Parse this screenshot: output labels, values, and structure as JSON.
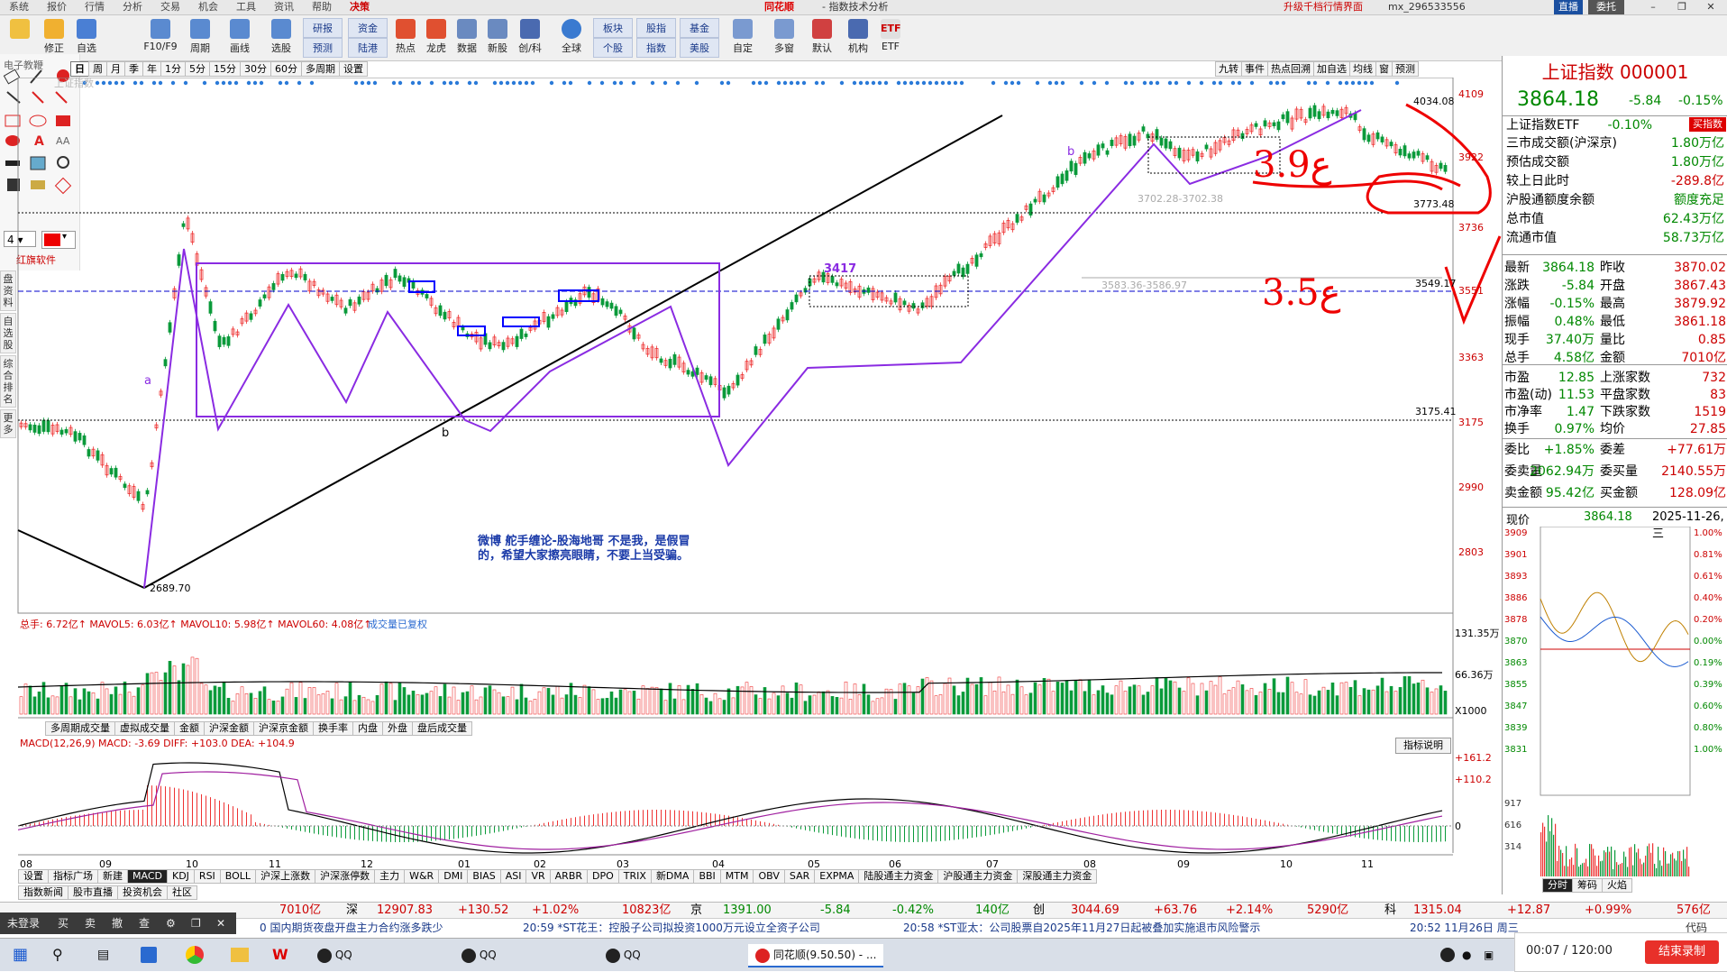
{
  "menu": {
    "items": [
      "系统",
      "报价",
      "行情",
      "分析",
      "交易",
      "机会",
      "工具",
      "资讯",
      "帮助",
      "决策"
    ],
    "logo": "同花顺",
    "window_title": "- 指数技术分析",
    "upgrade": "升级千档行情界面",
    "account": "mx_296533556",
    "direct": "直播",
    "invest": "委托"
  },
  "toolbar": {
    "buttons": [
      "修正",
      "自选",
      "F10/F9",
      "周期",
      "画线",
      "选股",
      "热点",
      "龙虎",
      "数据",
      "新股",
      "创/科",
      "全球",
      "自定",
      "多窗",
      "默认",
      "机构",
      "ETF"
    ],
    "pairs": [
      [
        "研报",
        "预测"
      ],
      [
        "资金",
        "陆港"
      ],
      [
        "板块",
        "个股"
      ],
      [
        "股指",
        "指数"
      ],
      [
        "基金",
        "美股"
      ]
    ]
  },
  "periods": [
    "日",
    "周",
    "月",
    "季",
    "年",
    "1分",
    "5分",
    "15分",
    "30分",
    "60分",
    "多周期",
    "设置"
  ],
  "right_tabs": [
    "九转",
    "事件",
    "热点回溯",
    "加自选",
    "均线",
    "窗",
    "预测"
  ],
  "left_tools": {
    "label": "电子教鞭",
    "brand": "红旗软件",
    "line_width": "4"
  },
  "side_tabs": [
    "盘资料",
    "自选股",
    "综合排名",
    "更多"
  ],
  "chart": {
    "watermark": "上证指数",
    "y_labels": [
      "4109",
      "3922",
      "3736",
      "3551",
      "3363",
      "3175",
      "2990",
      "2803"
    ],
    "price_tags": {
      "high": "4034.08",
      "level1": "3773.48",
      "level2": "3549.17",
      "level3": "3175.41",
      "low": "2689.70"
    },
    "zone_text1": "3702.28-3702.38",
    "zone_text2": "3583.36-3586.97",
    "tag_3417": "3417",
    "label_a": "a",
    "label_b": "b",
    "label_b2": "b",
    "disclaimer1": "微博 舵手缠论-股海地哥 不是我，是假冒",
    "disclaimer2": "的，希望大家擦亮眼睛，不要上当受骗。",
    "handwriting1": "3.9ع",
    "handwriting2": "3.5ع"
  },
  "volume": {
    "header": "总手: 6.72亿↑ MAVOL5: 6.03亿↑ MAVOL10: 5.98亿↑ MAVOL60: 4.08亿↑",
    "status": "成交量已复权",
    "y_labels": [
      "131.35万",
      "66.36万",
      "X1000"
    ],
    "tabs": [
      "多周期成交量",
      "虚拟成交量",
      "金额",
      "沪深金额",
      "沪深京金额",
      "换手率",
      "内盘",
      "外盘",
      "盘后成交量"
    ]
  },
  "macd": {
    "header": "MACD(12,26,9) MACD: -3.69  DIFF: +103.0  DEA: +104.9",
    "explain": "指标说明",
    "y_labels": [
      "+161.2",
      "+110.2",
      "0"
    ]
  },
  "x_labels": [
    "08",
    "09",
    "10",
    "11",
    "12",
    "01",
    "02",
    "03",
    "04",
    "05",
    "06",
    "07",
    "08",
    "09",
    "10",
    "11"
  ],
  "bottom_tabs": [
    "设置",
    "指标广场",
    "新建",
    "MACD",
    "KDJ",
    "RSI",
    "BOLL",
    "沪深上涨数",
    "沪深涨停数",
    "主力",
    "W&R",
    "DMI",
    "BIAS",
    "ASI",
    "VR",
    "ARBR",
    "DPO",
    "TRIX",
    "新DMA",
    "BBI",
    "MTM",
    "OBV",
    "SAR",
    "EXPMA",
    "陆股通主力资金",
    "沪股通主力资金",
    "深股通主力资金"
  ],
  "bottom_tabs2": [
    "指数新闻",
    "股市直播",
    "投资机会",
    "社区"
  ],
  "right": {
    "title": "上证指数 000001",
    "price": "3864.18",
    "change": "-5.84",
    "pct": "-0.15%",
    "etf_label": "上证指数ETF",
    "etf_pct": "-0.10%",
    "etf_btn": "买指数",
    "rows": [
      [
        "三市成交额(沪深京)",
        "1.80万亿"
      ],
      [
        "预估成交额",
        "1.80万亿"
      ],
      [
        "较上日此时",
        "-289.8亿"
      ],
      [
        "沪股通额度余额",
        "额度充足"
      ],
      [
        "总市值",
        "62.43万亿"
      ],
      [
        "流通市值",
        "58.73万亿"
      ]
    ],
    "quote": [
      [
        "最新",
        "3864.18",
        "昨收",
        "3870.02"
      ],
      [
        "涨跌",
        "-5.84",
        "开盘",
        "3867.43"
      ],
      [
        "涨幅",
        "-0.15%",
        "最高",
        "3879.92"
      ],
      [
        "振幅",
        "0.48%",
        "最低",
        "3861.18"
      ],
      [
        "现手",
        "37.40万",
        "量比",
        "0.85"
      ],
      [
        "总手",
        "4.58亿",
        "金额",
        "7010亿"
      ]
    ],
    "stats": [
      [
        "市盈",
        "12.85",
        "上涨家数",
        "732"
      ],
      [
        "市盈(动)",
        "11.53",
        "平盘家数",
        "83"
      ],
      [
        "市净率",
        "1.47",
        "下跌家数",
        "1519"
      ],
      [
        "换手",
        "0.97%",
        "均价",
        "27.85"
      ]
    ],
    "order": [
      [
        "委比",
        "+1.85%",
        "委差",
        "+77.61万"
      ],
      [
        "委卖量",
        "2062.94万",
        "委买量",
        "2140.55万"
      ],
      [
        "卖金额",
        "95.42亿",
        "买金额",
        "128.09亿"
      ]
    ],
    "mini": {
      "label": "现价",
      "price": "3864.18",
      "date": "2025-11-26,三",
      "y_left": [
        "3909",
        "3901",
        "3893",
        "3886",
        "3878",
        "3870",
        "3863",
        "3855",
        "3847",
        "3839",
        "3831",
        "917",
        "616",
        "314"
      ],
      "y_right": [
        "1.00%",
        "0.81%",
        "0.61%",
        "0.40%",
        "0.20%",
        "0.00%",
        "0.19%",
        "0.39%",
        "0.60%",
        "0.80%",
        "1.00%"
      ],
      "tabs": [
        "分时",
        "筹码",
        "火焰"
      ]
    }
  },
  "ticker": [
    {
      "label": "",
      "value": "7010亿"
    },
    {
      "label": "深",
      "value": "12907.83",
      "chg": "+130.52",
      "pct": "+1.02%",
      "amt": "10823亿"
    },
    {
      "label": "京",
      "value": "1391.00",
      "chg": "-5.84",
      "pct": "-0.42%",
      "amt": "140亿"
    },
    {
      "label": "创",
      "value": "3044.69",
      "chg": "+63.76",
      "pct": "+2.14%",
      "amt": "5290亿"
    },
    {
      "label": "科",
      "value": "1315.04",
      "chg": "+12.87",
      "pct": "+0.99%",
      "amt": "576亿"
    }
  ],
  "news": [
    "0 国内期货夜盘开盘主力合约涨多跌少",
    "20:59 *ST花王：控股子公司拟投资1000万元设立全资子公司",
    "20:58 *ST亚太：公司股票自2025年11月27日起被叠加实施退市风险警示",
    "20:52 11月26日 周三"
  ],
  "news_code": "代码",
  "bottom_left": [
    "未登录",
    "买",
    "卖",
    "撤",
    "查"
  ],
  "taskbar": {
    "apps": [
      "QQ",
      "QQ",
      "QQ",
      "同花顺(9.50.50) - ..."
    ],
    "rec_time": "00:07 / 120:00",
    "end_btn": "结束录制"
  }
}
